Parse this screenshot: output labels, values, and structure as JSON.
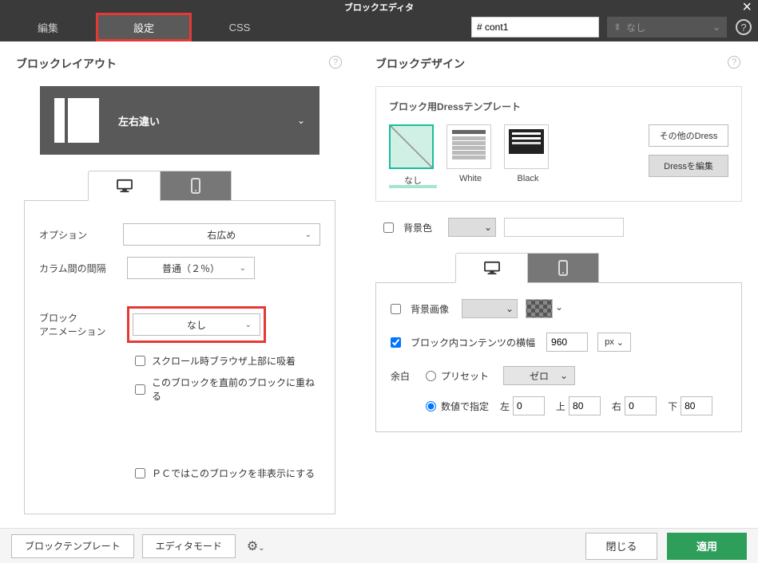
{
  "app": {
    "title": "ブロックエディタ"
  },
  "tabs": {
    "edit": "編集",
    "settings": "設定",
    "css": "CSS"
  },
  "id_field": {
    "value": "# cont1"
  },
  "top_dropdown": {
    "value": "なし"
  },
  "left": {
    "title": "ブロックレイアウト",
    "layout": {
      "label": "左右違い"
    },
    "option": {
      "label": "オプション",
      "value": "右広め"
    },
    "column_gap": {
      "label": "カラム間の間隔",
      "value": "普通（２％）"
    },
    "block_anim": {
      "label1": "ブロック",
      "label2": "アニメーション",
      "value": "なし"
    },
    "chk_sticky": "スクロール時ブラウザ上部に吸着",
    "chk_overlap": "このブロックを直前のブロックに重ねる",
    "chk_hide_pc": "ＰＣではこのブロックを非表示にする"
  },
  "right": {
    "title": "ブロックデザイン",
    "dress_title": "ブロック用Dressテンプレート",
    "dress": {
      "none": "なし",
      "white": "White",
      "black": "Black"
    },
    "btn_other": "その他のDress",
    "btn_edit": "Dressを編集",
    "bgcolor_label": "背景色",
    "bgimage_label": "背景画像",
    "content_width_label": "ブロック内コンテンツの横幅",
    "content_width_value": "960",
    "unit": "px",
    "margin": {
      "label": "余白",
      "preset": "プリセット",
      "preset_value": "ゼロ",
      "numeric": "数値で指定",
      "left_l": "左",
      "left_v": "0",
      "top_l": "上",
      "top_v": "80",
      "right_l": "右",
      "right_v": "0",
      "bottom_l": "下",
      "bottom_v": "80"
    }
  },
  "footer": {
    "template": "ブロックテンプレート",
    "editor_mode": "エディタモード",
    "close": "閉じる",
    "apply": "適用"
  }
}
